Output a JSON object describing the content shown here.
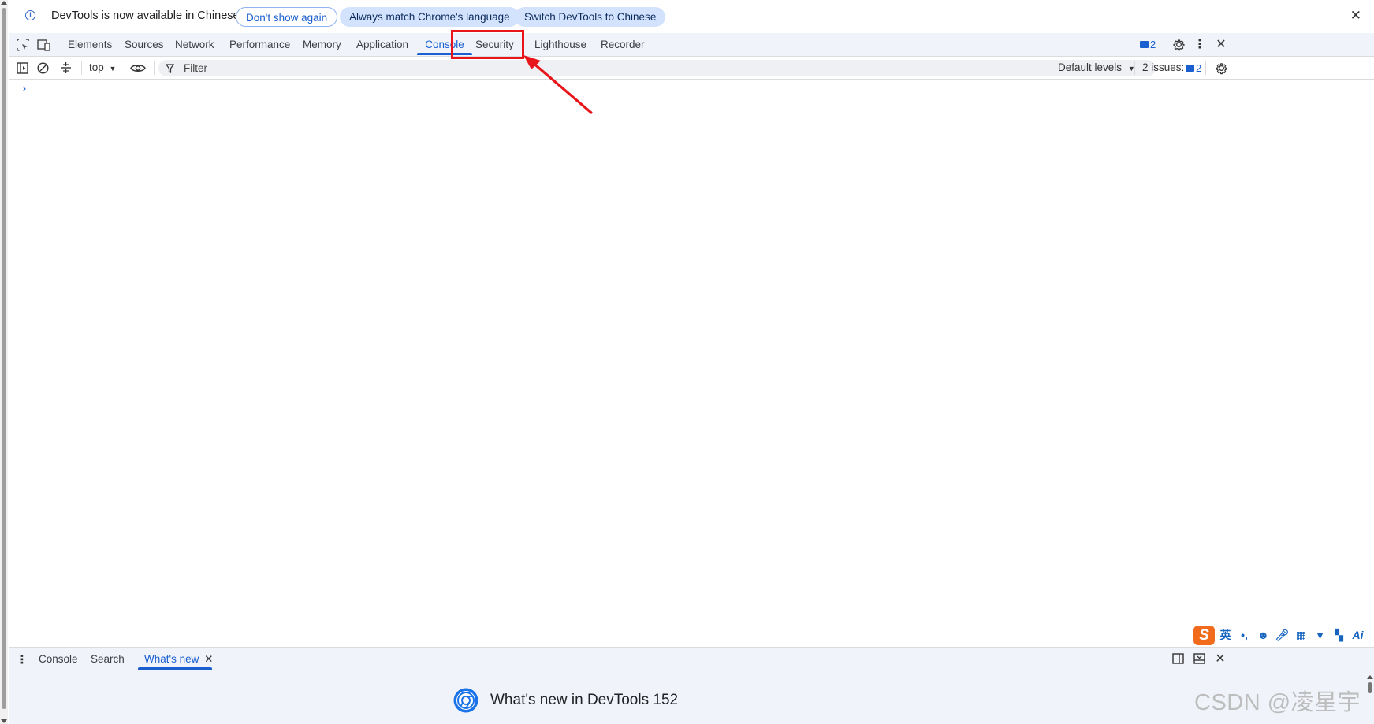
{
  "infobar": {
    "message": "DevTools is now available in Chinese",
    "dont_show_again": "Don't show again",
    "always_match": "Always match Chrome's language",
    "switch_to_chinese": "Switch DevTools to Chinese"
  },
  "main_tabs": [
    {
      "label": "Elements"
    },
    {
      "label": "Sources"
    },
    {
      "label": "Network"
    },
    {
      "label": "Performance"
    },
    {
      "label": "Memory"
    },
    {
      "label": "Application"
    },
    {
      "label": "Console",
      "active": true
    },
    {
      "label": "Security"
    },
    {
      "label": "Lighthouse"
    },
    {
      "label": "Recorder"
    }
  ],
  "toolbar_right": {
    "issues_badge_count": "2"
  },
  "console_toolbar": {
    "context": "top",
    "filter_placeholder": "Filter",
    "levels": "Default levels",
    "issues_label": "2 issues:",
    "issues_count": "2"
  },
  "drawer": {
    "tabs": [
      {
        "label": "Console"
      },
      {
        "label": "Search"
      },
      {
        "label": "What's new",
        "active": true
      }
    ],
    "whats_new_title": "What's new in DevTools 152"
  },
  "ime_bar": {
    "logo": "S",
    "lang": "英",
    "punct": "•,"
  },
  "watermark": "CSDN @凌星宇",
  "colors": {
    "accent": "#1a5fd0",
    "annotation_red": "#e8161b",
    "toolbar_bg": "#f0f4fa"
  }
}
